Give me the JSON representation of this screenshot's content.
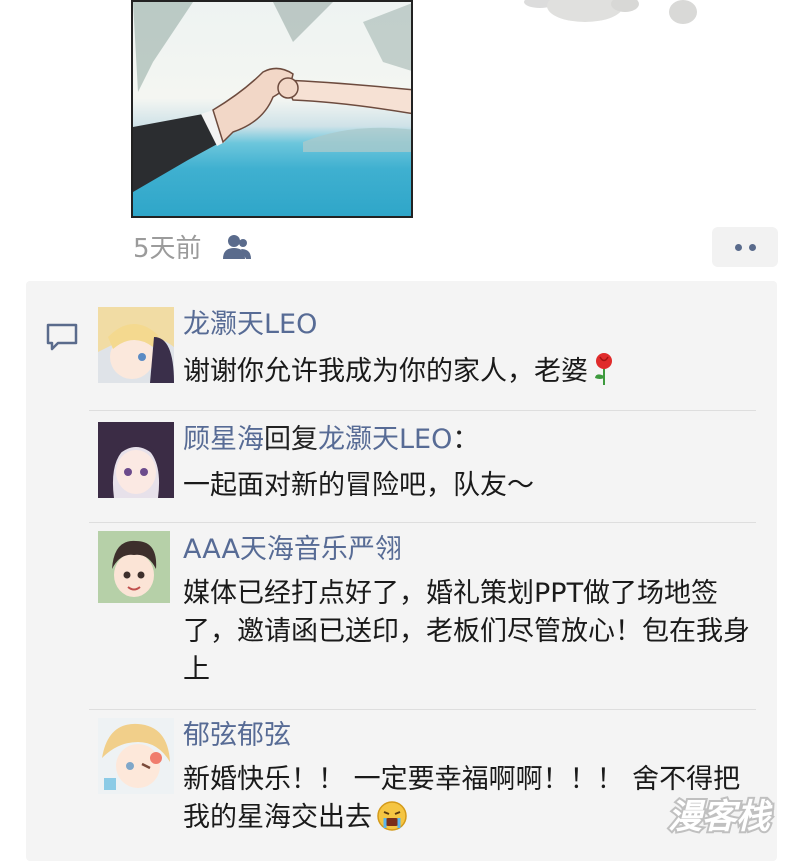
{
  "post": {
    "time": "5天前",
    "privacy_icon": "friends-icon",
    "more_icon": "more-dots-icon"
  },
  "comments": [
    {
      "name": "龙灏天LEO",
      "text": "谢谢你允许我成为你的家人，老婆",
      "emoji": "rose-icon"
    },
    {
      "name": "顾星海",
      "reply_word": "回复",
      "reply_to": "龙灏天LEO",
      "colon": "：",
      "text": "一起面对新的冒险吧，队友～"
    },
    {
      "name": "AAA天海音乐严翎",
      "text": "媒体已经打点好了，婚礼策划PPT做了场地签了，邀请函已送印，老板们尽管放心！包在我身上"
    },
    {
      "name": "郁弦郁弦",
      "text": "新婚快乐！！ 一定要幸福啊啊！！！ 舍不得把我的星海交出去",
      "emoji": "crying-face-icon"
    }
  ],
  "watermark": {
    "text": "漫客栈"
  },
  "colors": {
    "link": "#576b95",
    "panel": "#f4f4f4",
    "meta": "#9b9b9b"
  }
}
